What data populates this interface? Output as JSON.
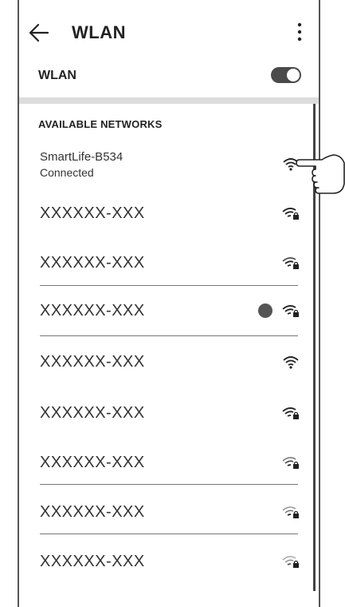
{
  "header": {
    "title": "WLAN",
    "back_icon": "arrow-left-icon",
    "menu_icon": "more-vertical-icon"
  },
  "wlan": {
    "label": "WLAN",
    "enabled": true
  },
  "section": {
    "title": "AVAILABLE NETWORKS"
  },
  "networks": [
    {
      "name": "SmartLife-B534",
      "status": "Connected",
      "locked": false
    },
    {
      "name": "XXXXXX-XXX",
      "locked": true
    },
    {
      "name": "XXXXXX-XXX",
      "locked": true
    },
    {
      "name": "XXXXXX-XXX",
      "locked": true,
      "extra_icon": "settings-badge-icon"
    },
    {
      "name": "XXXXXX-XXX",
      "locked": false
    },
    {
      "name": "XXXXXX-XXX",
      "locked": true
    },
    {
      "name": "XXXXXX-XXX",
      "locked": true
    },
    {
      "name": "XXXXXX-XXX",
      "locked": true
    },
    {
      "name": "XXXXXX-XXX",
      "locked": true
    }
  ]
}
